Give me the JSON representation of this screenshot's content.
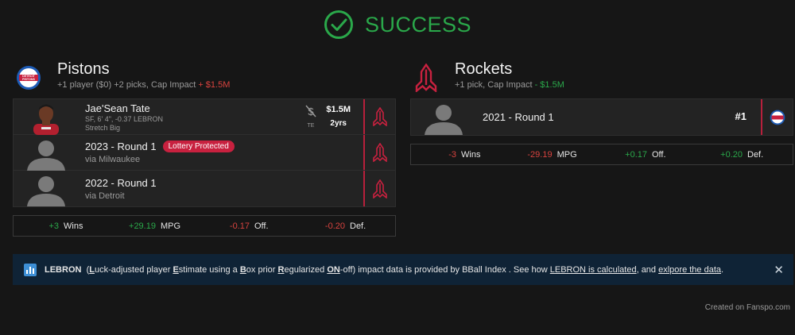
{
  "banner": {
    "text": "SUCCESS",
    "color": "#2aa84a"
  },
  "pistons": {
    "name": "Pistons",
    "summary": "+1 player ($0) +2 picks, Cap Impact ",
    "cap_impact": "+ $1.5M",
    "logo_text": "DETROIT PISTONS",
    "receives": [
      {
        "name": "Jae'Sean Tate",
        "line1": "SF, 6' 4\", -0.37 LEBRON",
        "line2": "Stretch Big",
        "te_label": "TE",
        "salary": "$1.5M",
        "years": "2yrs"
      },
      {
        "name": "2023 - Round 1",
        "badge": "Lottery Protected",
        "via": "via Milwaukee"
      },
      {
        "name": "2022 - Round 1",
        "via": "via Detroit"
      }
    ],
    "stats": {
      "wins_val": "+3",
      "wins_lbl": "Wins",
      "mpg_val": "+29.19",
      "mpg_lbl": "MPG",
      "off_val": "-0.17",
      "off_lbl": "Off.",
      "def_val": "-0.20",
      "def_lbl": "Def."
    }
  },
  "rockets": {
    "name": "Rockets",
    "summary": "+1 pick, Cap Impact ",
    "cap_impact": "- $1.5M",
    "receives": [
      {
        "name": "2021 - Round 1",
        "pick_number": "#1"
      }
    ],
    "stats": {
      "wins_val": "-3",
      "wins_lbl": "Wins",
      "mpg_val": "-29.19",
      "mpg_lbl": "MPG",
      "off_val": "+0.17",
      "off_lbl": "Off.",
      "def_val": "+0.20",
      "def_lbl": "Def."
    }
  },
  "info": {
    "title": "LEBRON",
    "open": "(",
    "L": "L",
    "w1": "uck-adjusted player ",
    "E": "E",
    "w2": "stimate using a ",
    "B": "B",
    "w3": "ox prior ",
    "R": "R",
    "w4": "egularized ",
    "ON": "ON",
    "w5": "-off) impact data is provided by BBall Index . See how ",
    "link1": "LEBRON is calculated",
    "w6": ", and ",
    "link2": "exlpore the data",
    "end": ".",
    "close": "✕"
  },
  "footer": "Created on Fanspo.com",
  "colors": {
    "positive": "#2aa84a",
    "negative": "#d9433f",
    "rockets_red": "#b8203c",
    "pistons_blue": "#1d5bb5",
    "info_bg": "#0f2336"
  },
  "icons": [
    "check-circle-icon",
    "pistons-logo-icon",
    "rockets-logo-icon",
    "player-silhouette-icon",
    "no-dollar-icon",
    "chart-icon",
    "close-icon"
  ]
}
